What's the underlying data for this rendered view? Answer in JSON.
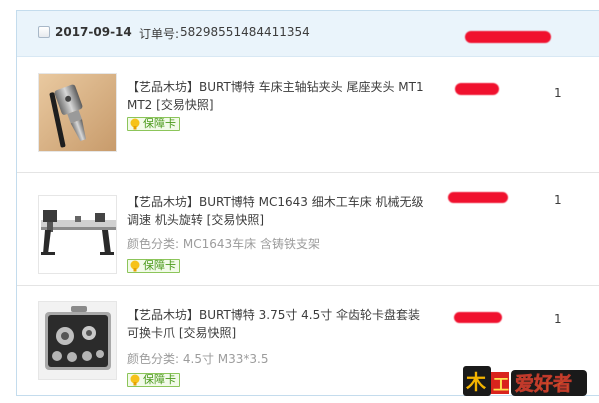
{
  "order": {
    "date": "2017-09-14",
    "order_no_label": "订单号:",
    "order_no": "58298551484411354"
  },
  "items": [
    {
      "title": "【艺品木坊】BURT博特 车床主轴钻夹头 尾座夹头 MT1 MT2",
      "snapshot": "[交易快照]",
      "guarantee": "保障卡",
      "quantity": "1"
    },
    {
      "title": "【艺品木坊】BURT博特 MC1643 细木工车床 机械无级调速 机头旋转",
      "snapshot": "[交易快照]",
      "sku_label": "颜色分类:",
      "sku_value": "MC1643车床 含铸铁支架",
      "guarantee": "保障卡",
      "quantity": "1"
    },
    {
      "title": "【艺品木坊】BURT博特 3.75寸 4.5寸 伞齿轮卡盘套装 可换卡爪",
      "snapshot": "[交易快照]",
      "sku_label": "颜色分类:",
      "sku_value": "4.5寸 M33*3.5",
      "guarantee": "保障卡",
      "quantity": "1"
    }
  ],
  "watermark": {
    "text": "木工爱好者"
  }
}
